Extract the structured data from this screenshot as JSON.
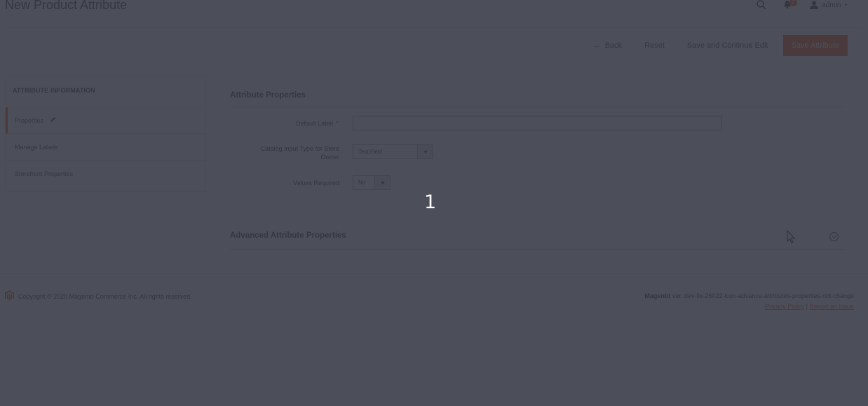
{
  "header": {
    "title": "New Product Attribute",
    "notification_count": "2",
    "user": "admin"
  },
  "actions": {
    "back": "Back",
    "reset": "Reset",
    "save_continue": "Save and Continue Edit",
    "save": "Save Attribute"
  },
  "sidebar": {
    "title": "ATTRIBUTE INFORMATION",
    "items": [
      {
        "label": "Properties"
      },
      {
        "label": "Manage Labels"
      },
      {
        "label": "Storefront Properties"
      }
    ]
  },
  "form": {
    "section_title": "Attribute Properties",
    "default_label": {
      "label": "Default Label",
      "required": "*",
      "value": ""
    },
    "input_type": {
      "label_line1": "Catalog Input Type for Store",
      "label_line2": "Owner",
      "value": "Text Field"
    },
    "values_required": {
      "label": "Values Required",
      "value": "No"
    },
    "advanced_title": "Advanced Attribute Properties"
  },
  "footer": {
    "copyright": "Copyright © 2020 Magento Commerce Inc. All rights reserved.",
    "brand": "Magento",
    "version": " ver. dev-fix-26022-icon-advance-attributes-properties-not-change",
    "privacy": "Privacy Policy",
    "separator": " | ",
    "report": "Report an Issue"
  },
  "overlay": {
    "counter": "1",
    "color": "#333743"
  },
  "colors": {
    "accent": "#eb5202",
    "text": "#41362f"
  }
}
